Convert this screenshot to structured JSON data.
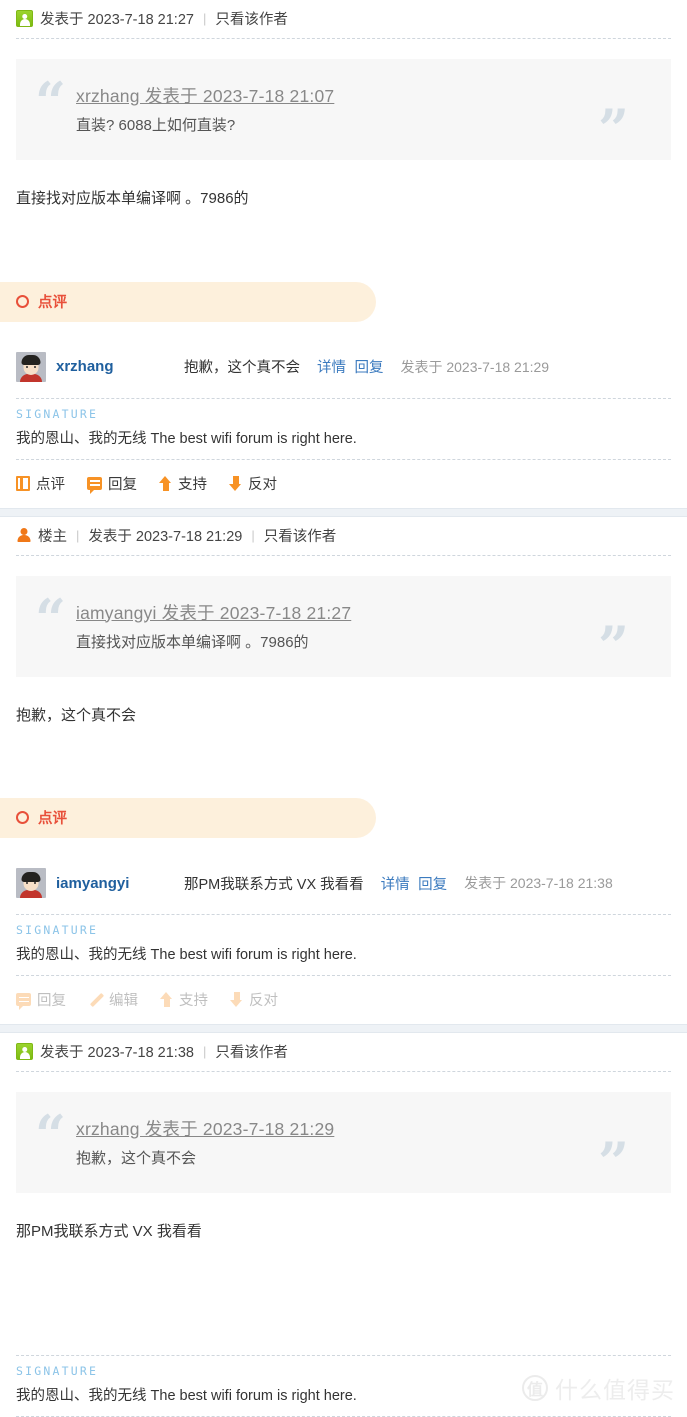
{
  "posts": [
    {
      "id": "post-1",
      "header": {
        "avatar_icon": "green-user-icon",
        "badge": null,
        "posted_label": "发表于 2023-7-18 21:27",
        "separator": "|",
        "only_author_label": "只看该作者"
      },
      "quote": {
        "author": "xrzhang",
        "author_line": "xrzhang 发表于 2023-7-18 21:07",
        "body": "直装? 6088上如何直装?",
        "open_mark": "“",
        "close_mark": "”"
      },
      "body": "直接找对应版本单编译啊 。7986的",
      "comment_section": {
        "icon": "circle-ring-icon",
        "label": "点评",
        "comments": [
          {
            "avatar": "user-avatar",
            "username": "xrzhang",
            "text": "抱歉，这个真不会",
            "detail_link": "详情",
            "reply_link": "回复",
            "date": "发表于 2023-7-18 21:29"
          }
        ]
      },
      "signature": {
        "label": "SIGNATURE",
        "text": "我的恩山、我的无线 The best wifi forum is right here."
      },
      "actions": {
        "disabled": false,
        "items": [
          {
            "icon": "book-icon",
            "label": "点评"
          },
          {
            "icon": "speech-bubble-icon",
            "label": "回复"
          },
          {
            "icon": "arrow-up-icon",
            "label": "支持"
          },
          {
            "icon": "arrow-down-icon",
            "label": "反对"
          }
        ]
      }
    },
    {
      "id": "post-2",
      "header": {
        "avatar_icon": "orange-user-icon",
        "badge": "楼主",
        "posted_label": "发表于 2023-7-18 21:29",
        "separator": "|",
        "only_author_label": "只看该作者"
      },
      "quote": {
        "author": "iamyangyi",
        "author_line": "iamyangyi 发表于 2023-7-18 21:27",
        "body": "直接找对应版本单编译啊 。7986的",
        "open_mark": "“",
        "close_mark": "”"
      },
      "body": "抱歉，这个真不会",
      "comment_section": {
        "icon": "circle-ring-icon",
        "label": "点评",
        "comments": [
          {
            "avatar": "user-avatar",
            "username": "iamyangyi",
            "text": "那PM我联系方式 VX 我看看",
            "detail_link": "详情",
            "reply_link": "回复",
            "date": "发表于 2023-7-18 21:38"
          }
        ]
      },
      "signature": {
        "label": "SIGNATURE",
        "text": "我的恩山、我的无线 The best wifi forum is right here."
      },
      "actions": {
        "disabled": true,
        "items": [
          {
            "icon": "speech-bubble-icon",
            "label": "回复"
          },
          {
            "icon": "pencil-icon",
            "label": "编辑"
          },
          {
            "icon": "arrow-up-icon",
            "label": "支持"
          },
          {
            "icon": "arrow-down-icon",
            "label": "反对"
          }
        ]
      }
    },
    {
      "id": "post-3",
      "header": {
        "avatar_icon": "green-user-icon",
        "badge": null,
        "posted_label": "发表于 2023-7-18 21:38",
        "separator": "|",
        "only_author_label": "只看该作者"
      },
      "quote": {
        "author": "xrzhang",
        "author_line": "xrzhang 发表于 2023-7-18 21:29",
        "body": "抱歉，这个真不会",
        "open_mark": "“",
        "close_mark": "”"
      },
      "body": "那PM我联系方式 VX 我看看",
      "signature": {
        "label": "SIGNATURE",
        "text": "我的恩山、我的无线 The best wifi forum is right here."
      }
    }
  ],
  "watermark": {
    "badge": "值",
    "text": "什么值得买"
  },
  "colors": {
    "accent_orange": "#f79225",
    "comment_red": "#e8503a",
    "comment_bar_bg": "#fdf0dc",
    "link_blue": "#3c7bbf",
    "username_blue": "#1f5f9e",
    "quote_bg": "#f7f7f7",
    "quote_mark": "#d5dee5",
    "signature_label": "#8cc4e8",
    "divider_bg": "#eef2f6"
  }
}
